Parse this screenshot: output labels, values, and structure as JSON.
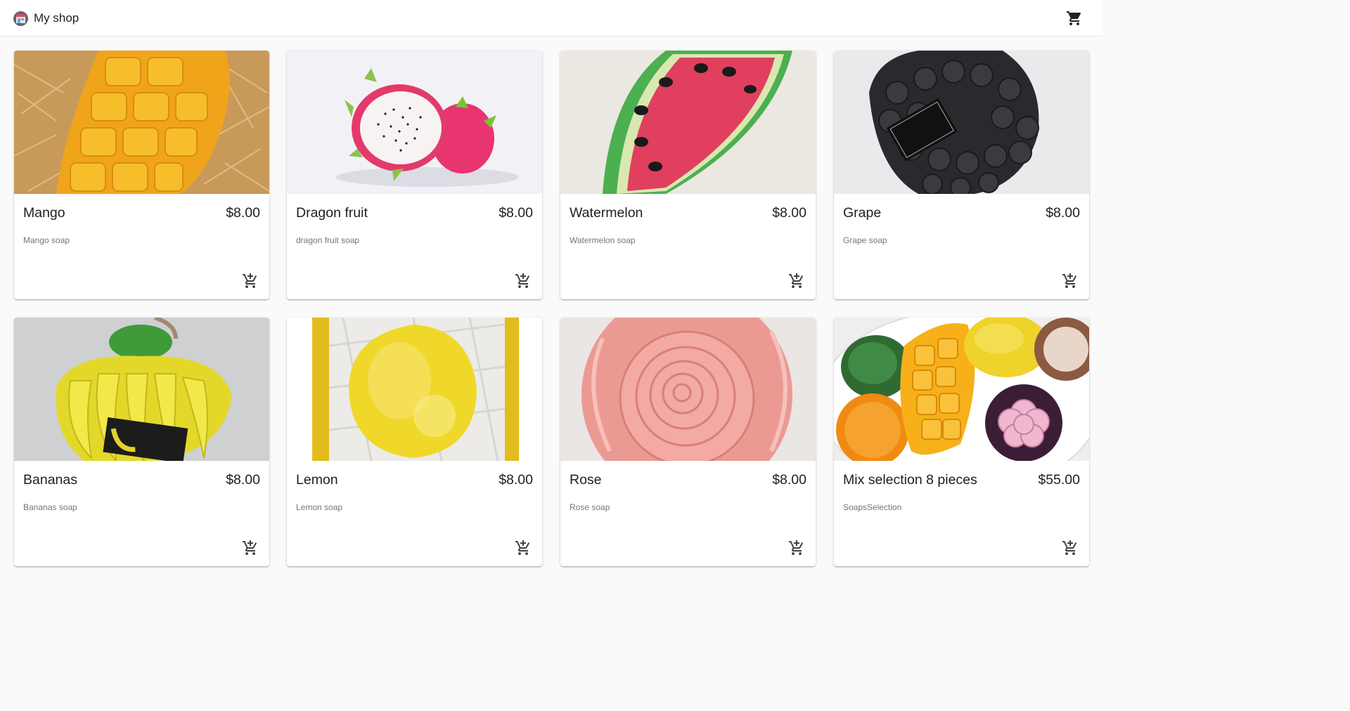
{
  "app": {
    "title": "My shop",
    "cart_icon": "shopping-cart-icon"
  },
  "products": [
    {
      "name": "Mango",
      "price": "$8.00",
      "description": "Mango soap",
      "image": "mango-soap-image"
    },
    {
      "name": "Dragon fruit",
      "price": "$8.00",
      "description": "dragon fruit soap",
      "image": "dragon-fruit-soap-image"
    },
    {
      "name": "Watermelon",
      "price": "$8.00",
      "description": "Watermelon soap",
      "image": "watermelon-soap-image"
    },
    {
      "name": "Grape",
      "price": "$8.00",
      "description": "Grape soap",
      "image": "grape-soap-image"
    },
    {
      "name": "Bananas",
      "price": "$8.00",
      "description": "Bananas soap",
      "image": "bananas-soap-image"
    },
    {
      "name": "Lemon",
      "price": "$8.00",
      "description": "Lemon soap",
      "image": "lemon-soap-image"
    },
    {
      "name": "Rose",
      "price": "$8.00",
      "description": "Rose soap",
      "image": "rose-soap-image"
    },
    {
      "name": "Mix selection 8 pieces",
      "price": "$55.00",
      "description": "SoapsSelection",
      "image": "mixed-soaps-image"
    }
  ],
  "add_to_cart_icon": "add-shopping-cart-icon",
  "colors": {
    "background": "#fafafa",
    "card": "#ffffff",
    "text": "#212121",
    "secondary_text": "#757575",
    "icon": "#424242"
  }
}
